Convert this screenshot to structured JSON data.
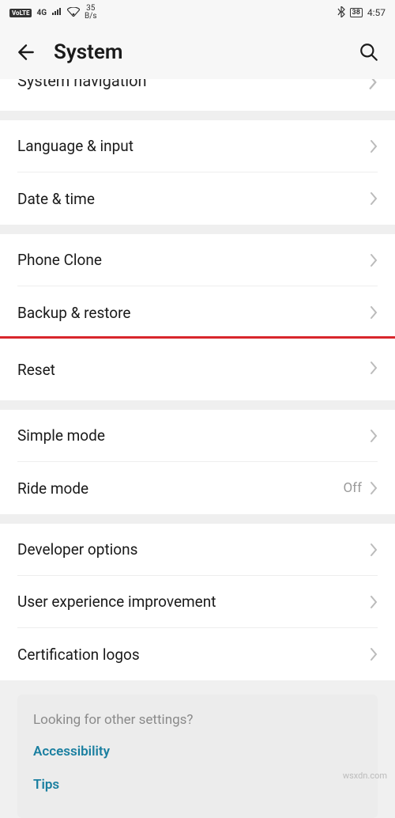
{
  "status": {
    "volte": "VoLTE",
    "network": "4G",
    "speed_top": "35",
    "speed_bottom": "B/s",
    "battery": "38",
    "time": "4:57"
  },
  "header": {
    "title": "System"
  },
  "partial": {
    "label": "System navigation"
  },
  "groups": [
    {
      "items": [
        {
          "label": "Language & input",
          "value": ""
        },
        {
          "label": "Date & time",
          "value": ""
        }
      ]
    },
    {
      "items": [
        {
          "label": "Phone Clone",
          "value": ""
        },
        {
          "label": "Backup & restore",
          "value": ""
        }
      ]
    },
    {
      "highlighted": true,
      "items": [
        {
          "label": "Reset",
          "value": ""
        }
      ]
    },
    {
      "items": [
        {
          "label": "Simple mode",
          "value": ""
        },
        {
          "label": "Ride mode",
          "value": "Off"
        }
      ]
    },
    {
      "items": [
        {
          "label": "Developer options",
          "value": ""
        },
        {
          "label": "User experience improvement",
          "value": ""
        },
        {
          "label": "Certification logos",
          "value": ""
        }
      ]
    }
  ],
  "hint": {
    "title": "Looking for other settings?",
    "links": [
      "Accessibility",
      "Tips"
    ]
  },
  "watermark": "wsxdn.com"
}
